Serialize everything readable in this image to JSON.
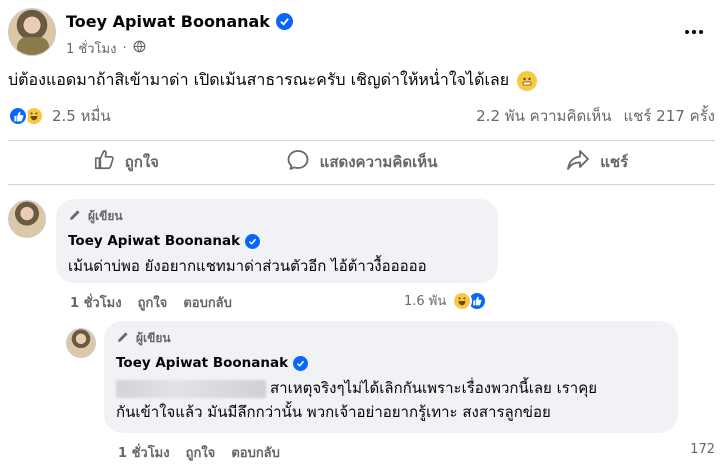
{
  "post": {
    "author": "Toey Apiwat Boonanak",
    "time": "1 ชั่วโมง",
    "separator": "·",
    "text": "บ่ต้องแอดมาถ้าสิเข้ามาด่า เปิดเม้นสาธารณะครับ เชิญด่าให้หน่ำใจได้เลย"
  },
  "stats": {
    "reactions": "2.5 หมื่น",
    "comments": "2.2 พัน ความคิดเห็น",
    "shares": "แชร์ 217 ครั้ง"
  },
  "actions": {
    "like": "ถูกใจ",
    "comment": "แสดงความคิดเห็น",
    "share": "แชร์"
  },
  "comment1": {
    "badge": "ผู้เขียน",
    "author": "Toey Apiwat Boonanak",
    "text": "เม้นด่าบ่พอ ยังอยากแชทมาด่าส่วนตัวอีก ไอ้ต้าวงื้อออออ",
    "time": "1 ชั่วโมง",
    "like": "ถูกใจ",
    "reply": "ตอบกลับ",
    "reactions": "1.6 พัน"
  },
  "comment2": {
    "badge": "ผู้เขียน",
    "author": "Toey Apiwat Boonanak",
    "line1": "สาเหตุจริงๆไม่ได้เลิกกันเพราะเรื่องพวกนี้เลย เราคุย",
    "line2": "กันเข้าใจแล้ว มันมีลึกกว่านั้น พวกเจ้าอย่าอยากรู้เทาะ สงสารลูกข่อย",
    "time": "1 ชั่วโมง",
    "like": "ถูกใจ",
    "reply": "ตอบกลับ",
    "count": "172"
  },
  "colors": {
    "accent": "#0866ff",
    "secondary_text": "#65676b",
    "bubble": "#f0f2f5"
  },
  "icons": [
    "verified-badge-icon",
    "globe-icon",
    "more-icon",
    "like-icon",
    "comment-icon",
    "share-icon",
    "pencil-icon",
    "haha-icon"
  ]
}
